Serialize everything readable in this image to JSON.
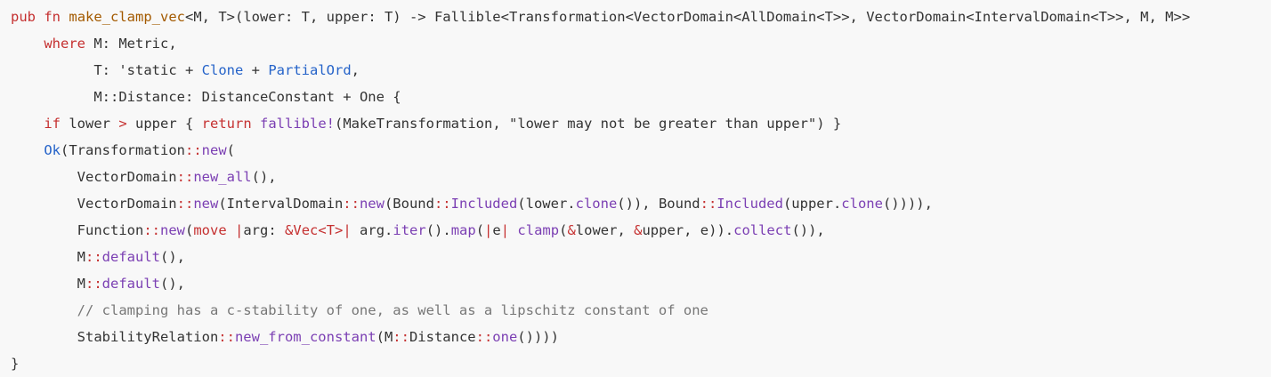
{
  "theme": {
    "background": "#f8f8f8",
    "text": "#333333",
    "keyword": "#c53030",
    "function_name": "#a35a00",
    "type": "#2563c9",
    "call": "#7b3fb3",
    "comment": "#777777"
  },
  "code": {
    "lines": [
      {
        "indent": "",
        "tokens": [
          {
            "text": "pub",
            "kind": "keyword"
          },
          {
            "text": " ",
            "kind": "plain"
          },
          {
            "text": "fn",
            "kind": "keyword"
          },
          {
            "text": " ",
            "kind": "plain"
          },
          {
            "text": "make_clamp_vec",
            "kind": "fn"
          },
          {
            "text": "<M, T>(lower: T, upper: T) -> Fallible<Transformation<VectorDomain<AllDomain<T>>, VectorDomain<IntervalDomain<T>>, M, M>>",
            "kind": "plain"
          }
        ]
      },
      {
        "indent": "    ",
        "tokens": [
          {
            "text": "where",
            "kind": "keyword"
          },
          {
            "text": " M: Metric,",
            "kind": "plain"
          }
        ]
      },
      {
        "indent": "          ",
        "tokens": [
          {
            "text": "T: 'static + ",
            "kind": "plain"
          },
          {
            "text": "Clone",
            "kind": "type"
          },
          {
            "text": " + ",
            "kind": "plain"
          },
          {
            "text": "PartialOrd",
            "kind": "type"
          },
          {
            "text": ",",
            "kind": "plain"
          }
        ]
      },
      {
        "indent": "          ",
        "tokens": [
          {
            "text": "M::Distance: DistanceConstant + One {",
            "kind": "plain"
          }
        ]
      },
      {
        "indent": "    ",
        "tokens": [
          {
            "text": "if",
            "kind": "keyword"
          },
          {
            "text": " lower ",
            "kind": "plain"
          },
          {
            "text": ">",
            "kind": "op"
          },
          {
            "text": " upper { ",
            "kind": "plain"
          },
          {
            "text": "return",
            "kind": "keyword"
          },
          {
            "text": " ",
            "kind": "plain"
          },
          {
            "text": "fallible!",
            "kind": "call"
          },
          {
            "text": "(MakeTransformation, \"lower may not be greater than upper\") }",
            "kind": "plain"
          }
        ]
      },
      {
        "indent": "    ",
        "tokens": [
          {
            "text": "Ok",
            "kind": "type"
          },
          {
            "text": "(Transformation",
            "kind": "plain"
          },
          {
            "text": "::",
            "kind": "sep"
          },
          {
            "text": "new",
            "kind": "call"
          },
          {
            "text": "(",
            "kind": "plain"
          }
        ]
      },
      {
        "indent": "        ",
        "tokens": [
          {
            "text": "VectorDomain",
            "kind": "plain"
          },
          {
            "text": "::",
            "kind": "sep"
          },
          {
            "text": "new_all",
            "kind": "call"
          },
          {
            "text": "(),",
            "kind": "plain"
          }
        ]
      },
      {
        "indent": "        ",
        "tokens": [
          {
            "text": "VectorDomain",
            "kind": "plain"
          },
          {
            "text": "::",
            "kind": "sep"
          },
          {
            "text": "new",
            "kind": "call"
          },
          {
            "text": "(IntervalDomain",
            "kind": "plain"
          },
          {
            "text": "::",
            "kind": "sep"
          },
          {
            "text": "new",
            "kind": "call"
          },
          {
            "text": "(Bound",
            "kind": "plain"
          },
          {
            "text": "::",
            "kind": "sep"
          },
          {
            "text": "Included",
            "kind": "call"
          },
          {
            "text": "(lower.",
            "kind": "plain"
          },
          {
            "text": "clone",
            "kind": "call"
          },
          {
            "text": "()), Bound",
            "kind": "plain"
          },
          {
            "text": "::",
            "kind": "sep"
          },
          {
            "text": "Included",
            "kind": "call"
          },
          {
            "text": "(upper.",
            "kind": "plain"
          },
          {
            "text": "clone",
            "kind": "call"
          },
          {
            "text": "()))),",
            "kind": "plain"
          }
        ]
      },
      {
        "indent": "        ",
        "tokens": [
          {
            "text": "Function",
            "kind": "plain"
          },
          {
            "text": "::",
            "kind": "sep"
          },
          {
            "text": "new",
            "kind": "call"
          },
          {
            "text": "(",
            "kind": "plain"
          },
          {
            "text": "move",
            "kind": "keyword"
          },
          {
            "text": " ",
            "kind": "plain"
          },
          {
            "text": "|",
            "kind": "op"
          },
          {
            "text": "arg: ",
            "kind": "plain"
          },
          {
            "text": "&",
            "kind": "op"
          },
          {
            "text": "Vec",
            "kind": "keyword"
          },
          {
            "text": "<T>",
            "kind": "keyword"
          },
          {
            "text": "|",
            "kind": "op"
          },
          {
            "text": " arg.",
            "kind": "plain"
          },
          {
            "text": "iter",
            "kind": "call"
          },
          {
            "text": "().",
            "kind": "plain"
          },
          {
            "text": "map",
            "kind": "call"
          },
          {
            "text": "(",
            "kind": "plain"
          },
          {
            "text": "|",
            "kind": "op"
          },
          {
            "text": "e",
            "kind": "plain"
          },
          {
            "text": "|",
            "kind": "op"
          },
          {
            "text": " ",
            "kind": "plain"
          },
          {
            "text": "clamp",
            "kind": "call"
          },
          {
            "text": "(",
            "kind": "plain"
          },
          {
            "text": "&",
            "kind": "op"
          },
          {
            "text": "lower, ",
            "kind": "plain"
          },
          {
            "text": "&",
            "kind": "op"
          },
          {
            "text": "upper, e)).",
            "kind": "plain"
          },
          {
            "text": "collect",
            "kind": "call"
          },
          {
            "text": "()),",
            "kind": "plain"
          }
        ]
      },
      {
        "indent": "        ",
        "tokens": [
          {
            "text": "M",
            "kind": "plain"
          },
          {
            "text": "::",
            "kind": "sep"
          },
          {
            "text": "default",
            "kind": "call"
          },
          {
            "text": "(),",
            "kind": "plain"
          }
        ]
      },
      {
        "indent": "        ",
        "tokens": [
          {
            "text": "M",
            "kind": "plain"
          },
          {
            "text": "::",
            "kind": "sep"
          },
          {
            "text": "default",
            "kind": "call"
          },
          {
            "text": "(),",
            "kind": "plain"
          }
        ]
      },
      {
        "indent": "        ",
        "tokens": [
          {
            "text": "// clamping has a c-stability of one, as well as a lipschitz constant of one",
            "kind": "comment"
          }
        ]
      },
      {
        "indent": "        ",
        "tokens": [
          {
            "text": "StabilityRelation",
            "kind": "plain"
          },
          {
            "text": "::",
            "kind": "sep"
          },
          {
            "text": "new_from_constant",
            "kind": "call"
          },
          {
            "text": "(M",
            "kind": "plain"
          },
          {
            "text": "::",
            "kind": "sep"
          },
          {
            "text": "Distance",
            "kind": "plain"
          },
          {
            "text": "::",
            "kind": "sep"
          },
          {
            "text": "one",
            "kind": "call"
          },
          {
            "text": "())))",
            "kind": "plain"
          }
        ]
      },
      {
        "indent": "",
        "tokens": [
          {
            "text": "}",
            "kind": "plain"
          }
        ]
      }
    ]
  }
}
